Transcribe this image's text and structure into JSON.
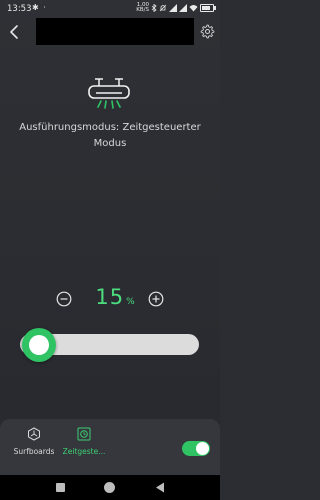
{
  "status_bar": {
    "time": "13:53",
    "left_icons": "✱ ·",
    "net_speed_value": "1,00",
    "net_speed_unit": "KB/S",
    "icons": [
      "bluetooth-icon",
      "mute-icon",
      "signal-icon",
      "signal-icon",
      "wifi-icon"
    ],
    "battery_level": 70
  },
  "header": {
    "title_redacted": true
  },
  "device": {
    "icon": "air-conditioner-icon",
    "mode_text": "Ausführungsmodus: Zeitgesteuerter Modus"
  },
  "control": {
    "value": "15",
    "unit": "%",
    "slider_fraction": 0.15
  },
  "bottom_tabs": [
    {
      "label": "Surfboards",
      "icon": "surfboard-icon",
      "active": false
    },
    {
      "label": "Zeitgeste...",
      "icon": "timer-icon",
      "active": true
    }
  ],
  "power_toggle": {
    "on": true
  },
  "colors": {
    "accent": "#2fc364",
    "accent_text": "#4cdd7f",
    "background": "#2b2d32",
    "panel": "#35373c",
    "track": "#dcdcdc"
  }
}
